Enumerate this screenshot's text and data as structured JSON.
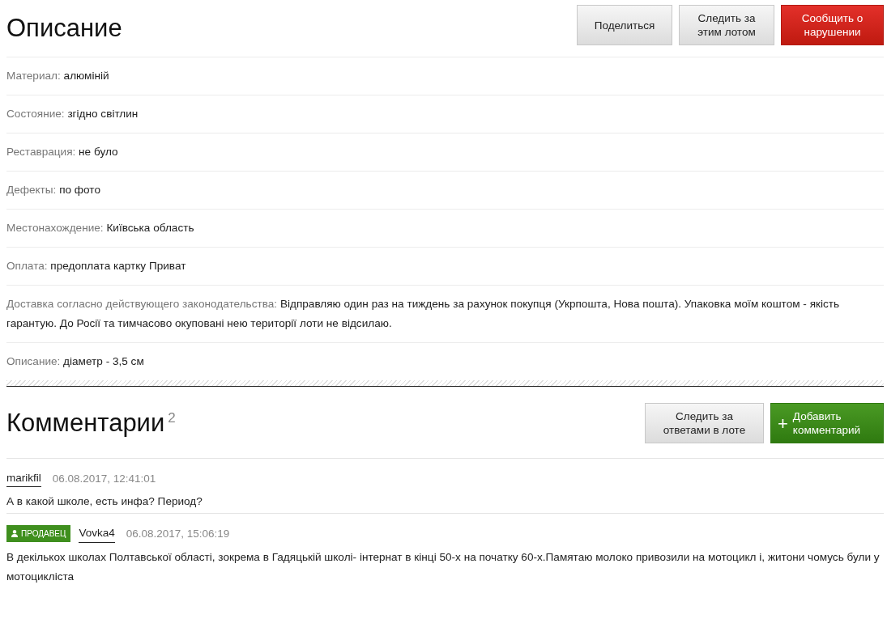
{
  "description": {
    "title": "Описание",
    "buttons": [
      {
        "label": "Поделиться",
        "kind": "default"
      },
      {
        "label": "Следить за этим лотом",
        "kind": "default"
      },
      {
        "label": "Сообщить о нарушении",
        "kind": "danger"
      }
    ],
    "fields": [
      {
        "label": "Материал:",
        "value": "алюміній"
      },
      {
        "label": "Состояние:",
        "value": "згідно світлин"
      },
      {
        "label": "Реставрация:",
        "value": "не було"
      },
      {
        "label": "Дефекты:",
        "value": "по фото"
      },
      {
        "label": "Местонахождение:",
        "value": "Київська область"
      },
      {
        "label": "Оплата:",
        "value": "предоплата картку Приват"
      },
      {
        "label": "Доставка согласно действующего законодательства:",
        "value": "Відправляю один раз на тиждень за рахунок покупця (Укрпошта, Нова пошта). Упаковка моїм коштом - якість гарантую. До Росії та тимчасово окуповані нею території лоти не відсилаю."
      },
      {
        "label": "Описание:",
        "value": "діаметр - 3,5 см"
      }
    ]
  },
  "comments_section": {
    "title": "Комментарии",
    "count": "2",
    "buttons": [
      {
        "label": "Следить за ответами в лоте",
        "kind": "default"
      },
      {
        "label": "Добавить комментарий",
        "kind": "success",
        "icon": "+"
      }
    ],
    "comments": [
      {
        "author": "marikfil",
        "date": "06.08.2017, 12:41:01",
        "text": "А в какой школе, есть инфа? Период?"
      },
      {
        "badge": "ПРОДАВЕЦ",
        "author": "Vovka4",
        "date": "06.08.2017, 15:06:19",
        "text": "В декількох школах Полтавської області, зокрема в Гадяцькій школі- інтернат в кінці 50-х на початку 60-х.Памятаю молоко привозили на мотоцикл і, житони чомусь були у мотоцикліста"
      }
    ]
  }
}
